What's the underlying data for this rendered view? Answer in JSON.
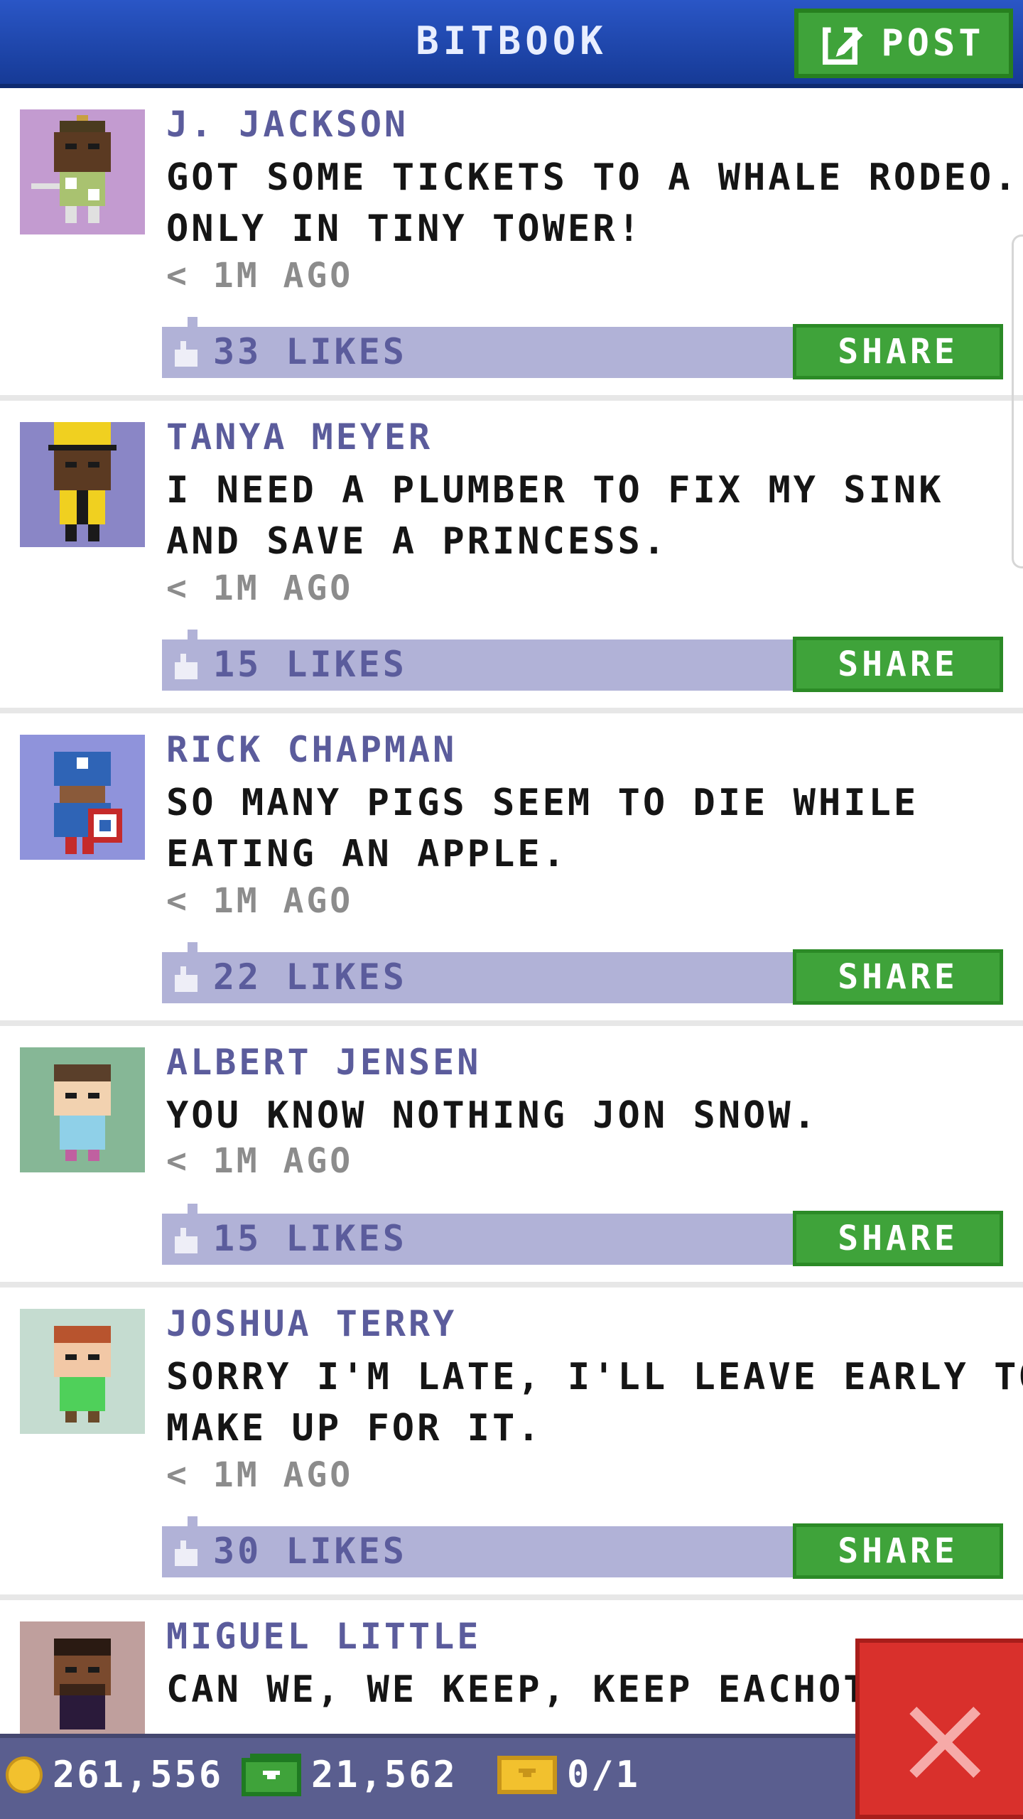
{
  "header": {
    "title": "BITBOOK",
    "post_label": "POST"
  },
  "posts": [
    {
      "author": "J. JACKSON",
      "message_lines": [
        "GOT SOME TICKETS TO A WHALE RODEO...",
        "ONLY IN TINY TOWER!"
      ],
      "time": "< 1M AGO",
      "likes": "33 LIKES",
      "share_label": "SHARE",
      "avatar_bg": "#c39bd0"
    },
    {
      "author": "TANYA MEYER",
      "message_lines": [
        "I NEED A PLUMBER TO FIX MY SINK",
        "AND SAVE A PRINCESS."
      ],
      "time": "< 1M AGO",
      "likes": "15 LIKES",
      "share_label": "SHARE",
      "avatar_bg": "#8a86c6"
    },
    {
      "author": "RICK CHAPMAN",
      "message_lines": [
        "SO MANY PIGS SEEM TO DIE WHILE",
        "EATING AN APPLE."
      ],
      "time": "< 1M AGO",
      "likes": "22 LIKES",
      "share_label": "SHARE",
      "avatar_bg": "#8f93db"
    },
    {
      "author": "ALBERT JENSEN",
      "message_lines": [
        "YOU KNOW NOTHING JON SNOW."
      ],
      "time": "< 1M AGO",
      "likes": "15 LIKES",
      "share_label": "SHARE",
      "avatar_bg": "#86b796"
    },
    {
      "author": "JOSHUA TERRY",
      "message_lines": [
        "SORRY I'M LATE, I'LL LEAVE EARLY TO",
        "MAKE UP FOR IT."
      ],
      "time": "< 1M AGO",
      "likes": "30 LIKES",
      "share_label": "SHARE",
      "avatar_bg": "#c5dcd0"
    },
    {
      "author": "MIGUEL LITTLE",
      "message_lines": [
        "CAN WE, WE KEEP, KEEP EACHOTH"
      ],
      "time": "",
      "likes": "",
      "share_label": "",
      "avatar_bg": "#bf9f9d"
    }
  ],
  "bottom_bar": {
    "coins": "261,556",
    "bux": "21,562",
    "tickets": "0/1"
  },
  "colors": {
    "header": "#1e47b0",
    "accent_green": "#3fa33a",
    "author_purple": "#5b5c9c",
    "likes_bar": "#b1b2d7",
    "close_red": "#d9302c"
  }
}
